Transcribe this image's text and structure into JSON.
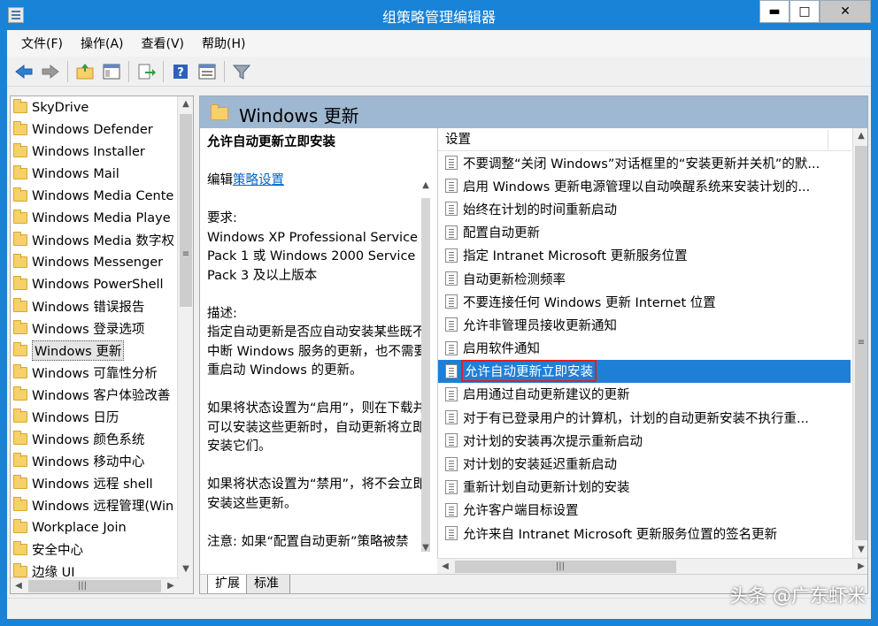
{
  "window": {
    "title": "组策略管理编辑器",
    "minimize": "▬",
    "maximize": "□",
    "close": "✕"
  },
  "menu": [
    "文件(F)",
    "操作(A)",
    "查看(V)",
    "帮助(H)"
  ],
  "toolbar": [
    "back-arrow-icon",
    "forward-arrow-icon",
    "up-folder-icon",
    "show-hide-tree-icon",
    "export-list-icon",
    "help-icon",
    "properties-icon",
    "filter-icon"
  ],
  "tree": {
    "items": [
      {
        "label": "SkyDrive"
      },
      {
        "label": "Windows Defender"
      },
      {
        "label": "Windows Installer"
      },
      {
        "label": "Windows Mail"
      },
      {
        "label": "Windows Media Cente"
      },
      {
        "label": "Windows Media Playe"
      },
      {
        "label": "Windows Media 数字权"
      },
      {
        "label": "Windows Messenger"
      },
      {
        "label": "Windows PowerShell"
      },
      {
        "label": "Windows 错误报告"
      },
      {
        "label": "Windows 登录选项"
      },
      {
        "label": "Windows 更新",
        "selected": true
      },
      {
        "label": "Windows 可靠性分析"
      },
      {
        "label": "Windows 客户体验改善"
      },
      {
        "label": "Windows 日历"
      },
      {
        "label": "Windows 颜色系统"
      },
      {
        "label": "Windows 移动中心"
      },
      {
        "label": "Windows 远程 shell"
      },
      {
        "label": "Windows 远程管理(Win"
      },
      {
        "label": "Workplace Join"
      },
      {
        "label": "安全中心"
      },
      {
        "label": "边缘 UI"
      }
    ]
  },
  "header": {
    "title": "Windows 更新"
  },
  "description": {
    "title": "允许自动更新立即安装",
    "edit_prefix": "编辑",
    "edit_link": "策略设置",
    "requirements_label": "要求:",
    "requirements_text": "Windows XP Professional Service Pack 1 或 Windows 2000 Service Pack 3 及以上版本",
    "description_label": "描述:",
    "description_text": "指定自动更新是否应自动安装某些既不中断 Windows 服务的更新，也不需要重启动 Windows 的更新。",
    "enabled_text": "如果将状态设置为“启用”，则在下载并可以安装这些更新时，自动更新将立即安装它们。",
    "disabled_text": "如果将状态设置为“禁用”，将不会立即安装这些更新。",
    "note_text": "注意: 如果“配置自动更新”策略被禁"
  },
  "settings": {
    "column_header": "设置",
    "rows": [
      {
        "label": "不要调整“关闭 Windows”对话框里的“安装更新并关机”的默..."
      },
      {
        "label": "启用 Windows 更新电源管理以自动唤醒系统来安装计划的..."
      },
      {
        "label": "始终在计划的时间重新启动"
      },
      {
        "label": "配置自动更新"
      },
      {
        "label": "指定 Intranet Microsoft 更新服务位置"
      },
      {
        "label": "自动更新检测频率"
      },
      {
        "label": "不要连接任何 Windows 更新 Internet 位置"
      },
      {
        "label": "允许非管理员接收更新通知"
      },
      {
        "label": "启用软件通知"
      },
      {
        "label": "允许自动更新立即安装",
        "selected": true
      },
      {
        "label": "启用通过自动更新建议的更新"
      },
      {
        "label": "对于有已登录用户的计算机，计划的自动更新安装不执行重..."
      },
      {
        "label": "对计划的安装再次提示重新启动"
      },
      {
        "label": "对计划的安装延迟重新启动"
      },
      {
        "label": "重新计划自动更新计划的安装"
      },
      {
        "label": "允许客户端目标设置"
      },
      {
        "label": "允许来自 Intranet Microsoft 更新服务位置的签名更新"
      }
    ]
  },
  "tabs": [
    "扩展",
    "标准"
  ],
  "watermark": "头条 @广东虾米"
}
